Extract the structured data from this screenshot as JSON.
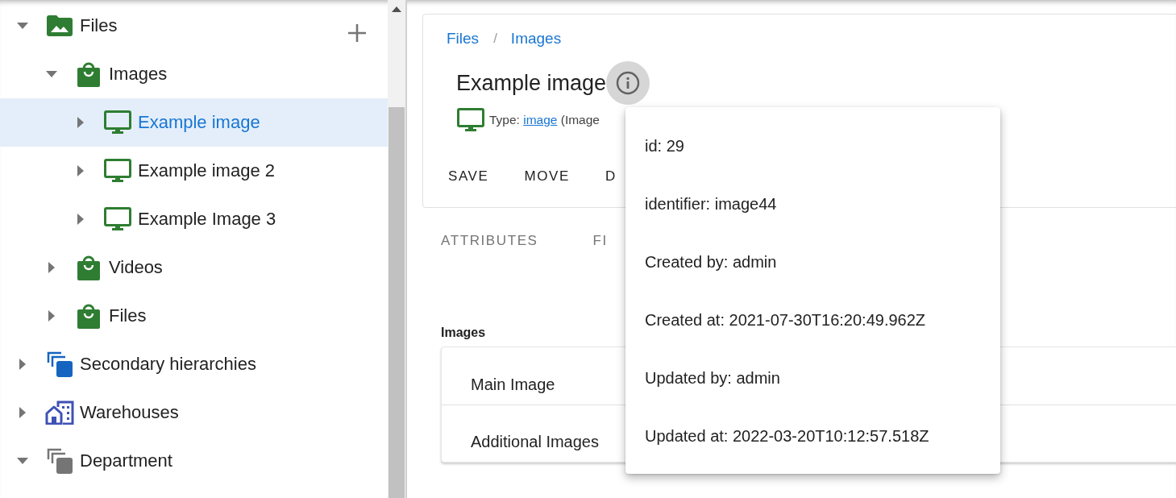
{
  "sidebar": {
    "tree": [
      {
        "label": "Files",
        "kind": "folder-image",
        "color": "#2e7d32",
        "expanded": true,
        "selected": false,
        "children": [
          {
            "label": "Images",
            "kind": "bag",
            "color": "#2e7d32",
            "expanded": true,
            "selected": false,
            "children": [
              {
                "label": "Example image",
                "kind": "monitor",
                "color": "#2e7d32",
                "expanded": false,
                "selected": true
              },
              {
                "label": "Example image 2",
                "kind": "monitor",
                "color": "#2e7d32",
                "expanded": false,
                "selected": false
              },
              {
                "label": "Example Image 3",
                "kind": "monitor",
                "color": "#2e7d32",
                "expanded": false,
                "selected": false
              }
            ]
          },
          {
            "label": "Videos",
            "kind": "bag",
            "color": "#2e7d32",
            "expanded": false,
            "selected": false
          },
          {
            "label": "Files",
            "kind": "bag",
            "color": "#2e7d32",
            "expanded": false,
            "selected": false
          }
        ]
      },
      {
        "label": "Secondary hierarchies",
        "kind": "stack",
        "color": "#1565c0",
        "expanded": false,
        "selected": false
      },
      {
        "label": "Warehouses",
        "kind": "buildings",
        "color": "#3f51b5",
        "expanded": false,
        "selected": false
      },
      {
        "label": "Department",
        "kind": "stack",
        "color": "#757575",
        "expanded": true,
        "selected": false
      }
    ]
  },
  "detail": {
    "breadcrumb": {
      "items": [
        "Files",
        "Images"
      ],
      "separator": "/"
    },
    "title": "Example image",
    "type_line": {
      "prefix": "Type:",
      "link": "image",
      "suffix": "(Image"
    },
    "actions": [
      "SAVE",
      "MOVE",
      "D"
    ],
    "tabs": [
      {
        "label": "ATTRIBUTES",
        "selected": false
      },
      {
        "label": "FI",
        "selected": false
      }
    ],
    "section_label": "Images",
    "image_fields": [
      "Main Image",
      "Additional Images"
    ]
  },
  "info_popup": {
    "lines": [
      "id: 29",
      "identifier: image44",
      "Created by: admin",
      "Created at: 2021-07-30T16:20:49.962Z",
      "Updated by: admin",
      "Updated at: 2022-03-20T10:12:57.518Z"
    ]
  }
}
